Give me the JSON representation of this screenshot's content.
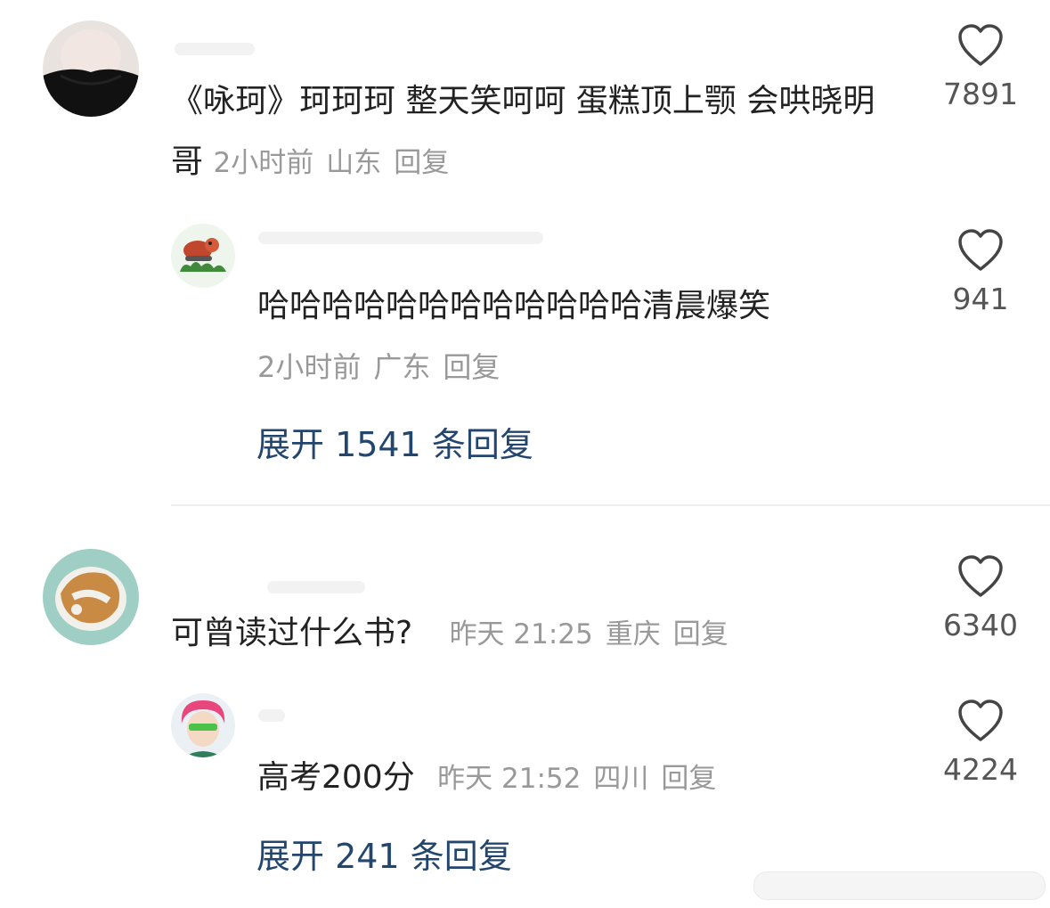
{
  "comments": [
    {
      "text": "《咏珂》珂珂珂 整天笑呵呵 蛋糕顶上颚 会哄晓明哥",
      "time": "2小时前",
      "location": "山东",
      "reply_label": "回复",
      "likes": "7891",
      "replies": [
        {
          "text": "哈哈哈哈哈哈哈哈哈哈哈哈清晨爆笑",
          "time": "2小时前",
          "location": "广东",
          "reply_label": "回复",
          "likes": "941"
        }
      ],
      "expand_label": "展开 1541 条回复"
    },
    {
      "text": "可曾读过什么书?",
      "time": "昨天 21:25",
      "location": "重庆",
      "reply_label": "回复",
      "likes": "6340",
      "replies": [
        {
          "text": "高考200分",
          "time": "昨天 21:52",
          "location": "四川",
          "reply_label": "回复",
          "likes": "4224"
        }
      ],
      "expand_label": "展开 241 条回复"
    }
  ],
  "colors": {
    "text": "#222222",
    "meta": "#999999",
    "expand_link": "#23466f",
    "like_icon": "#444444"
  },
  "icons": {
    "like": "heart-outline-icon"
  }
}
